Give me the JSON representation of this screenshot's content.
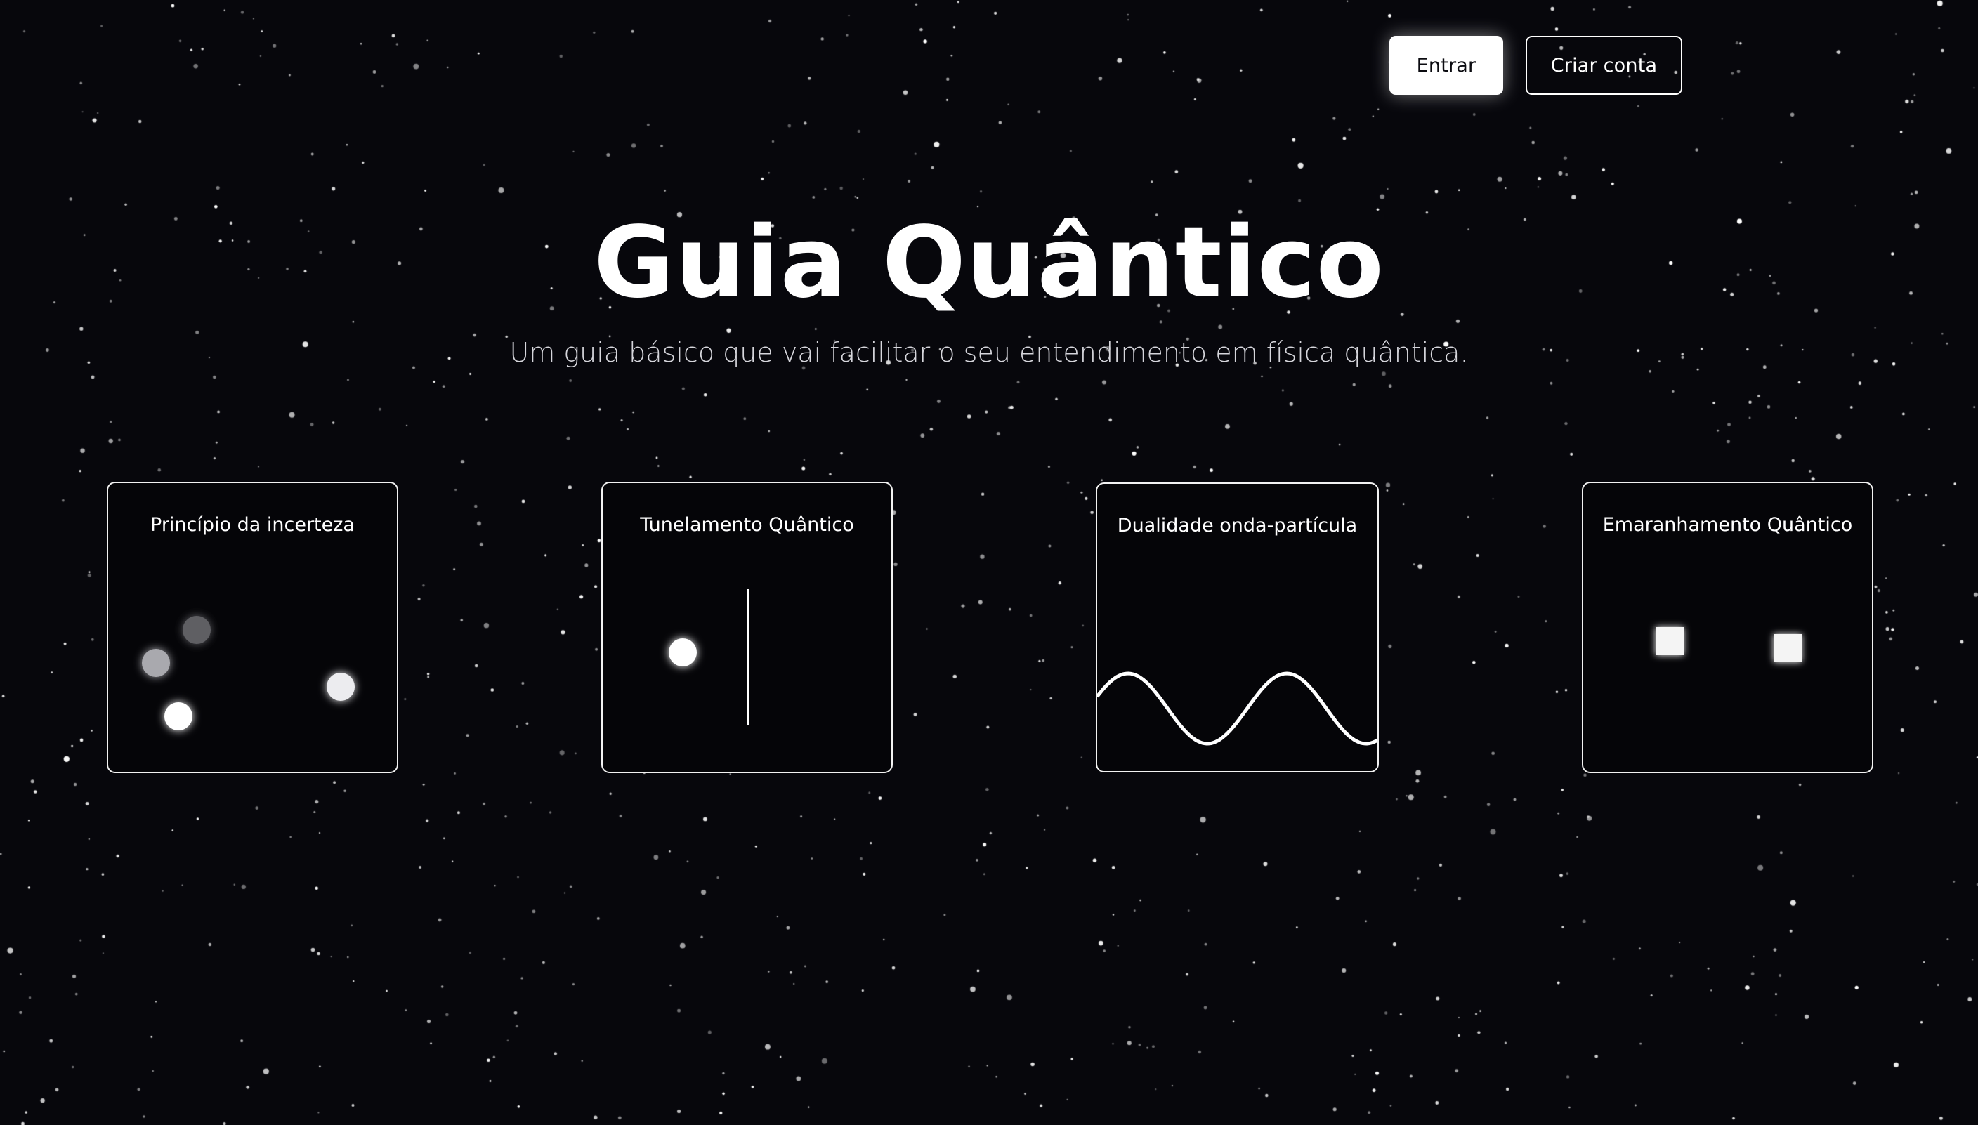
{
  "header": {
    "login_label": "Entrar",
    "signup_label": "Criar conta"
  },
  "hero": {
    "title": "Guia Quântico",
    "subtitle": "Um guia básico que vai facilitar o seu entendimento em física quântica."
  },
  "cards": [
    {
      "title": "Princípio da incerteza",
      "illustration": "uncertainty-particles"
    },
    {
      "title": "Tunelamento Quântico",
      "illustration": "tunneling-particle-barrier"
    },
    {
      "title": "Dualidade onda-partícula",
      "illustration": "sine-wave"
    },
    {
      "title": "Emaranhamento Quântico",
      "illustration": "entangled-squares"
    }
  ],
  "colors": {
    "background": "#07070c",
    "foreground": "#ffffff",
    "subtitle": "#d6d6dc"
  }
}
